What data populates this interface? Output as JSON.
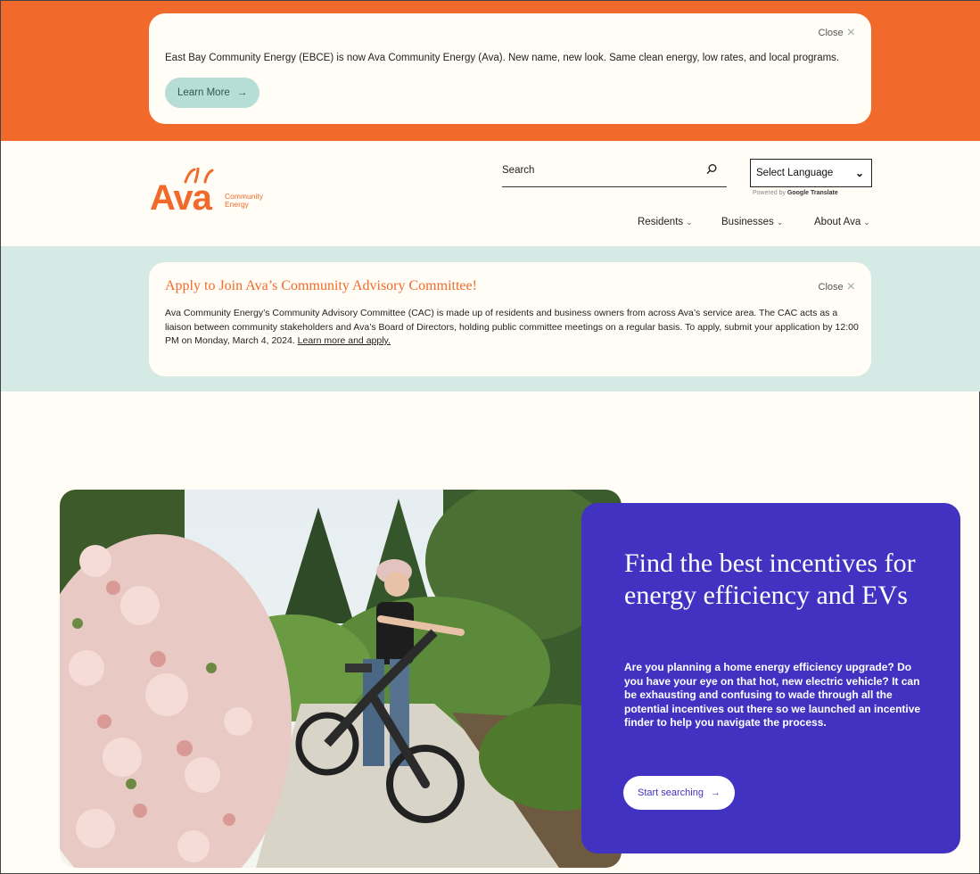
{
  "notice": {
    "close_label": "Close",
    "message": "East Bay Community Energy (EBCE) is now Ava Community Energy (Ava). New name, new look. Same clean energy, low rates, and local programs.",
    "button_label": "Learn More"
  },
  "header": {
    "logo_word": "Ava",
    "logo_sub_1": "Community",
    "logo_sub_2": "Energy",
    "search_placeholder": "Search",
    "language_select": "Select Language",
    "powered_by": "Powered by",
    "powered_service": "Google Translate",
    "nav": [
      {
        "label": "Residents"
      },
      {
        "label": "Businesses"
      },
      {
        "label": "About Ava"
      }
    ]
  },
  "cac_notice": {
    "title": "Apply to Join Ava’s Community Advisory Committee!",
    "close_label": "Close",
    "body": "Ava Community Energy’s Community Advisory Committee (CAC) is made up of residents and business owners from across Ava’s service area. The CAC acts as a liaison between community stakeholders and Ava’s Board of Directors, holding public committee meetings on a regular basis. To apply, submit your application by 12:00 PM on Monday, March 4, 2024. ",
    "link_label": "Learn more and apply."
  },
  "hero": {
    "heading": "Find the best incentives for energy efficiency and EVs",
    "description": "Are you planning a home energy efficiency upgrade? Do you have your eye on that hot, new electric vehicle? It can be exhausting and confusing to wade through all the potential incentives out there so we launched an incentive finder to help you navigate the process.",
    "button_label": "Start searching"
  },
  "colors": {
    "brand_orange": "#f26a2b",
    "mint": "#d6eae5",
    "hero_purple": "#4132c2"
  }
}
